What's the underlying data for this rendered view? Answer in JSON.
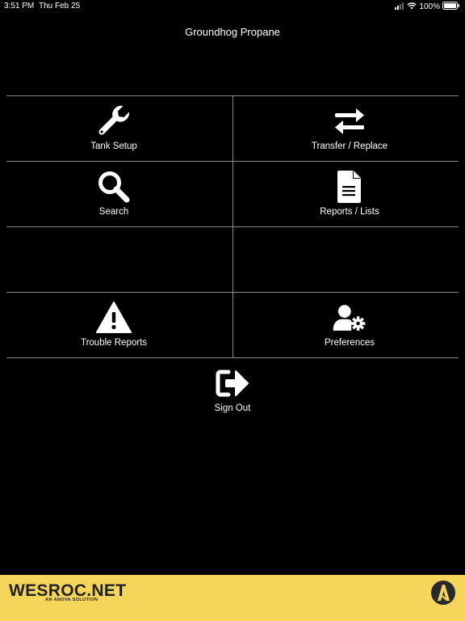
{
  "status_bar": {
    "time": "3:51 PM",
    "date": "Thu Feb 25",
    "battery": "100%"
  },
  "app": {
    "title": "Groundhog Propane"
  },
  "menu": {
    "tank_setup": {
      "label": "Tank Setup",
      "icon": "wrench-icon"
    },
    "transfer_replace": {
      "label": "Transfer / Replace",
      "icon": "exchange-arrows-icon"
    },
    "search": {
      "label": "Search",
      "icon": "magnifier-icon"
    },
    "reports_lists": {
      "label": "Reports / Lists",
      "icon": "document-icon"
    },
    "trouble_reports": {
      "label": "Trouble Reports",
      "icon": "warning-triangle-icon"
    },
    "preferences": {
      "label": "Preferences",
      "icon": "user-gear-icon"
    },
    "sign_out": {
      "label": "Sign Out",
      "icon": "sign-out-icon"
    }
  },
  "footer": {
    "brand": "WESROC.NET",
    "tagline": "AN ANOVA SOLUTION"
  },
  "colors": {
    "background": "#000000",
    "divider": "#8a8a8a",
    "footer": "#f5d55a"
  }
}
